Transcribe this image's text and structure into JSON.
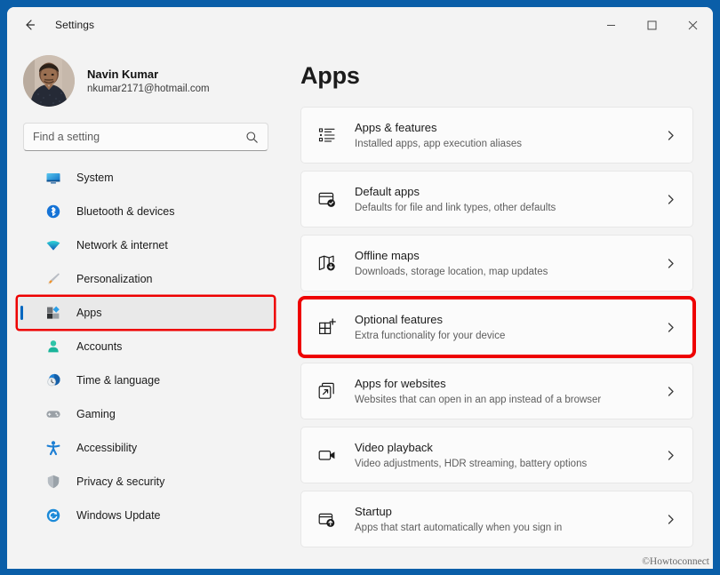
{
  "window": {
    "title": "Settings",
    "back_icon": "back-arrow-icon",
    "minimize_label": "─",
    "maximize_label": "□",
    "close_label": "✕"
  },
  "account": {
    "name": "Navin Kumar",
    "email": "nkumar2171@hotmail.com"
  },
  "search": {
    "placeholder": "Find a setting",
    "value": ""
  },
  "sidebar": {
    "items": [
      {
        "label": "System",
        "icon": "monitor-icon",
        "selected": false
      },
      {
        "label": "Bluetooth & devices",
        "icon": "bluetooth-icon",
        "selected": false
      },
      {
        "label": "Network & internet",
        "icon": "wifi-icon",
        "selected": false
      },
      {
        "label": "Personalization",
        "icon": "paintbrush-icon",
        "selected": false
      },
      {
        "label": "Apps",
        "icon": "apps-grid-icon",
        "selected": true
      },
      {
        "label": "Accounts",
        "icon": "person-icon",
        "selected": false
      },
      {
        "label": "Time & language",
        "icon": "clock-globe-icon",
        "selected": false
      },
      {
        "label": "Gaming",
        "icon": "gamepad-icon",
        "selected": false
      },
      {
        "label": "Accessibility",
        "icon": "accessibility-icon",
        "selected": false
      },
      {
        "label": "Privacy & security",
        "icon": "shield-icon",
        "selected": false
      },
      {
        "label": "Windows Update",
        "icon": "update-arrows-icon",
        "selected": false
      }
    ]
  },
  "main": {
    "heading": "Apps",
    "cards": [
      {
        "title": "Apps & features",
        "subtitle": "Installed apps, app execution aliases",
        "icon": "list-bullets-icon",
        "highlighted": false
      },
      {
        "title": "Default apps",
        "subtitle": "Defaults for file and link types, other defaults",
        "icon": "window-check-icon",
        "highlighted": false
      },
      {
        "title": "Offline maps",
        "subtitle": "Downloads, storage location, map updates",
        "icon": "map-download-icon",
        "highlighted": false
      },
      {
        "title": "Optional features",
        "subtitle": "Extra functionality for your device",
        "icon": "grid-plus-icon",
        "highlighted": true
      },
      {
        "title": "Apps for websites",
        "subtitle": "Websites that can open in an app instead of a browser",
        "icon": "external-link-icon",
        "highlighted": false
      },
      {
        "title": "Video playback",
        "subtitle": "Video adjustments, HDR streaming, battery options",
        "icon": "video-camera-icon",
        "highlighted": false
      },
      {
        "title": "Startup",
        "subtitle": "Apps that start automatically when you sign in",
        "icon": "window-up-arrow-icon",
        "highlighted": false
      }
    ],
    "chevron_icon": "chevron-right-icon"
  },
  "watermark": "©Howtoconnect",
  "colors": {
    "desktop": "#0a5ea8",
    "accent": "#0067c0",
    "annotation": "#ee0000",
    "sidebar_bg": "#f3f3f3",
    "card_bg": "#fbfbfb"
  }
}
